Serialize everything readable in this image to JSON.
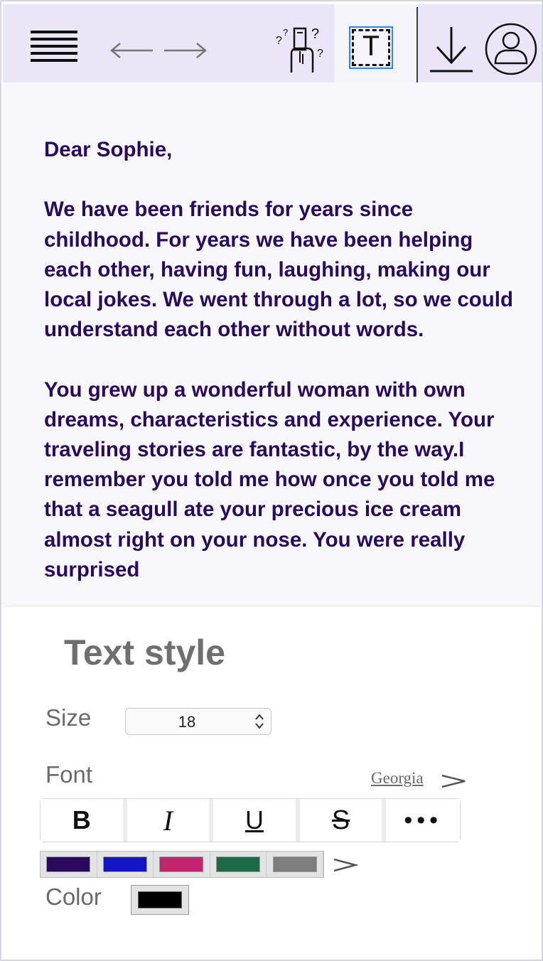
{
  "toolbar": {
    "icons": [
      "menu-icon",
      "back-arrow-icon",
      "forward-arrow-icon",
      "help-icon",
      "text-style-icon",
      "download-icon",
      "user-profile-icon"
    ],
    "text_style_glyph": "T"
  },
  "document": {
    "paragraphs": [
      "Dear Sophie,",
      "We have been friends for years since childhood. For years we have been helping each other, having fun, laughing, making our local jokes. We went through a lot, so we could understand each other without words.",
      "You grew up a wonderful woman with own dreams, characteristics and experience. Your traveling stories are fantastic, by the way.I remember you told me how once you told me that a seagull ate your precious ice cream almost right on your nose. You were really surprised"
    ],
    "text_color": "#2a0a5c"
  },
  "text_style_panel": {
    "title": "Text style",
    "size_label": "Size",
    "size_value": "18",
    "font_label": "Font",
    "font_value": "Georgia",
    "format_buttons": {
      "bold": "B",
      "italic": "I",
      "underline": "U",
      "strikethrough": "S",
      "more": "•••"
    },
    "swatch_colors": [
      "#2a0a5c",
      "#1515c8",
      "#c2256e",
      "#1d6b45",
      "#7d7d7d"
    ],
    "color_label": "Color",
    "current_color": "#000000"
  }
}
